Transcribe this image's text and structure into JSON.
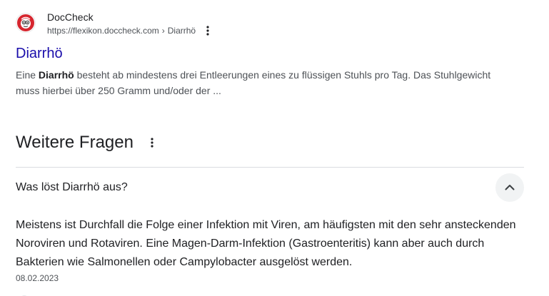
{
  "result": {
    "site_name": "DocCheck",
    "url": "https://flexikon.doccheck.com",
    "url_separator": "›",
    "breadcrumb": "Diarrhö",
    "more_icon": "vertical-dots-icon",
    "favicon_icon": "doccheck-logo-icon",
    "title": "Diarrhö",
    "snippet_before": "Eine ",
    "snippet_bold": "Diarrhö",
    "snippet_after": " besteht ab mindestens drei Entleerungen eines zu flüssigen Stuhls pro Tag. Das Stuhlgewicht muss hierbei über 250 Gramm und/oder der ..."
  },
  "paa": {
    "title": "Weitere Fragen",
    "menu_icon": "vertical-dots-icon",
    "question": "Was löst Diarrhö aus?",
    "toggle_icon": "chevron-up-icon",
    "answer": "Meistens ist Durchfall die Folge einer Infektion mit Viren, am häufigsten mit den sehr ansteckenden Noroviren und Rotaviren. Eine Magen-Darm-Infektion (Gastroenteritis) kann aber auch durch Bakterien wie Salmonellen oder Campylobacter ausgelöst werden.",
    "date": "08.02.2023"
  },
  "colors": {
    "link": "#1a0dab",
    "text": "#202124",
    "secondary_text": "#4d5156",
    "divider": "#dadce0",
    "chevron_bg": "#f1f3f4",
    "favicon_red": "#d6262f"
  }
}
